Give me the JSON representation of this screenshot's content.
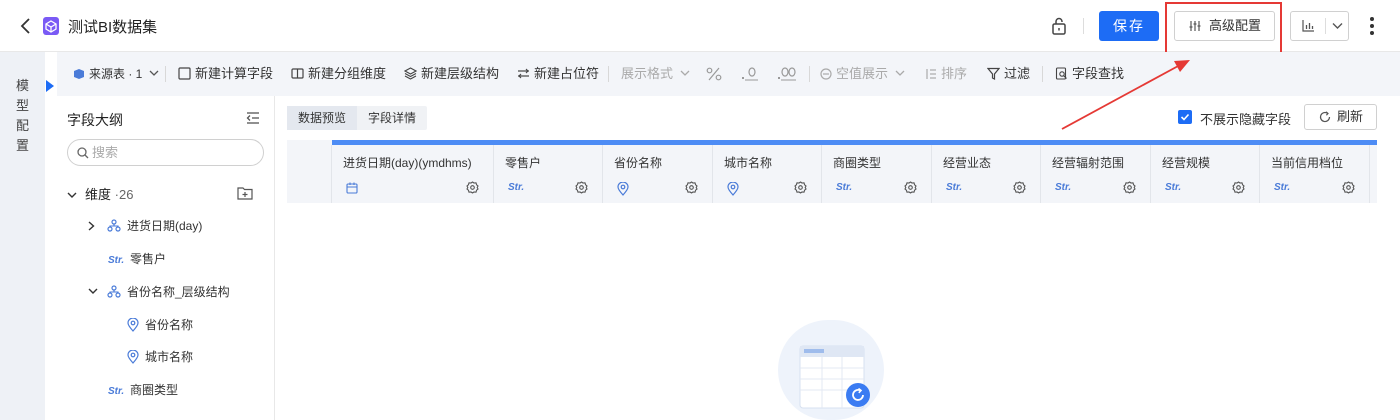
{
  "header": {
    "title": "测试BI数据集",
    "save_label": "保存",
    "advanced_label": "高级配置"
  },
  "rail": {
    "label": "模型配置"
  },
  "toolbar": {
    "source": "来源表 · 1",
    "items": [
      "新建计算字段",
      "新建分组维度",
      "新建层级结构",
      "新建占位符",
      "展示格式",
      "空值展示",
      "排序",
      "过滤",
      "字段查找"
    ]
  },
  "outline": {
    "title": "字段大纲",
    "search_placeholder": "搜索",
    "dimension_label": "维度",
    "dimension_count": "·26",
    "tree": [
      {
        "label": "进货日期(day)",
        "type": "hierarchy"
      },
      {
        "label": "零售户",
        "type": "Str."
      },
      {
        "label": "省份名称_层级结构",
        "type": "hierarchy"
      },
      {
        "label": "省份名称",
        "type": "geo"
      },
      {
        "label": "城市名称",
        "type": "geo"
      },
      {
        "label": "商圈类型",
        "type": "Str."
      }
    ]
  },
  "main": {
    "tabs": [
      "数据预览",
      "字段详情"
    ],
    "hide_fields_label": "不展示隐藏字段",
    "refresh_label": "刷新",
    "columns": [
      {
        "label": "进货日期(day)(ymdhms)",
        "type": "date"
      },
      {
        "label": "零售户",
        "type": "Str."
      },
      {
        "label": "省份名称",
        "type": "geo"
      },
      {
        "label": "城市名称",
        "type": "geo"
      },
      {
        "label": "商圈类型",
        "type": "Str."
      },
      {
        "label": "经营业态",
        "type": "Str."
      },
      {
        "label": "经营辐射范围",
        "type": "Str."
      },
      {
        "label": "经营规模",
        "type": "Str."
      },
      {
        "label": "当前信用档位",
        "type": "Str."
      }
    ]
  },
  "colors": {
    "accent": "#1d6cf5",
    "annotation": "#e53935"
  }
}
